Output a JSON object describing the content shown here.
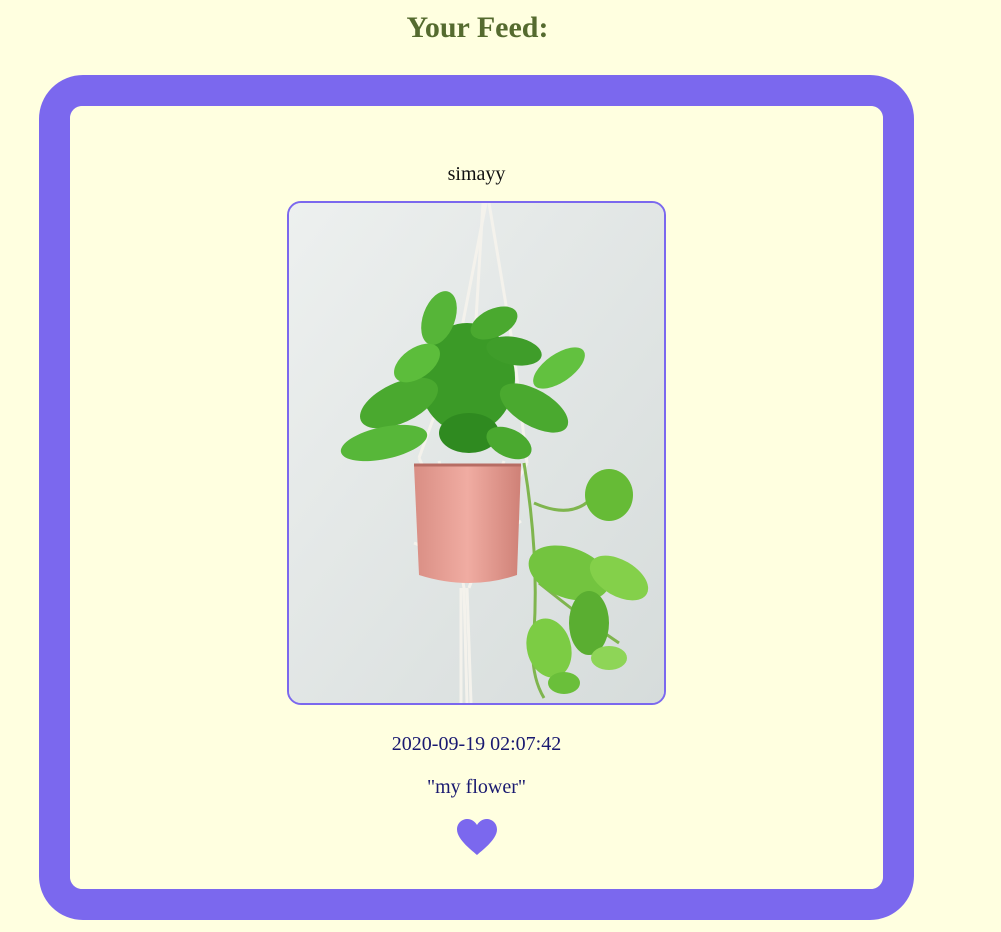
{
  "feed": {
    "title": "Your Feed:"
  },
  "post": {
    "username": "simayy",
    "timestamp": "2020-09-19 02:07:42",
    "caption": "\"my flower\"",
    "image_subject": "hanging pothos plant in pink pot"
  },
  "icons": {
    "like": "heart-icon"
  },
  "colors": {
    "background": "#ffffe0",
    "title": "#556b2f",
    "card_border": "#7b68ee",
    "text_dark": "#191970",
    "heart": "#7b68ee"
  }
}
